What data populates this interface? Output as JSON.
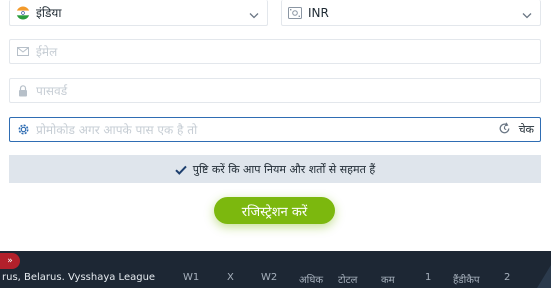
{
  "form": {
    "country": {
      "flag": "india-flag-icon",
      "value": "इंडिया"
    },
    "currency": {
      "icon": "currency-icon",
      "value": "INR"
    },
    "email": {
      "placeholder": "ईमेल"
    },
    "password": {
      "placeholder": "पासवर्ड"
    },
    "promo": {
      "placeholder": "प्रोमोकोड अगर आपके पास एक है तो",
      "check_label": "चेक"
    },
    "agree": {
      "checked": true,
      "label": "पुष्टि करें कि आप नियम और शर्तों से सहमत हैं"
    },
    "register_label": "रजिस्ट्रेशन करें"
  },
  "bottom": {
    "expand_label": "»",
    "league": "rus, Belarus. Vysshaya League",
    "columns": [
      "W1",
      "X",
      "W2",
      "अधिक",
      "टोटल",
      "कम",
      "1",
      "हैंडीकैप",
      "2"
    ]
  },
  "colors": {
    "accent_blue": "#2f6db3",
    "register_green": "#7cb80e",
    "agree_bg": "#dfe5ec",
    "bottom_bg": "#1d2734"
  }
}
